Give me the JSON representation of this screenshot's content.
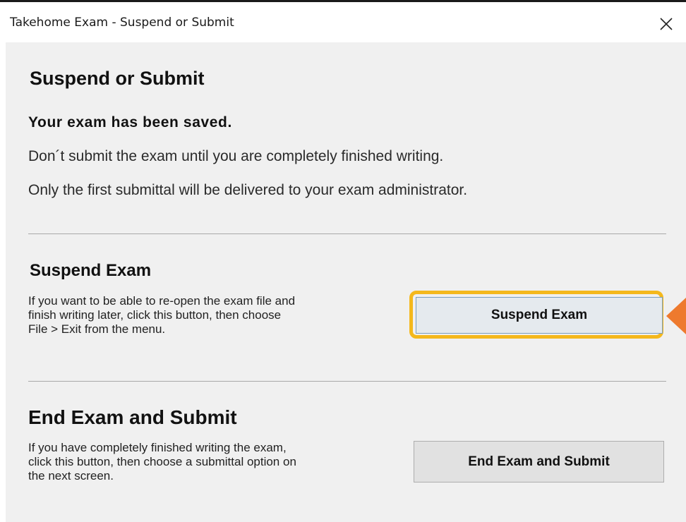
{
  "window": {
    "title": "Takehome Exam - Suspend or Submit",
    "close_glyph": "✕"
  },
  "intro": {
    "heading": "Suspend or Submit",
    "saved": "Your exam has been saved.",
    "line1": "Don´t submit the exam until you are completely finished writing.",
    "line2": "Only the first submittal will be delivered to your exam administrator."
  },
  "suspend": {
    "heading": "Suspend Exam",
    "description": "If you want to be able to re-open the exam file and\nfinish writing later, click this button, then choose\nFile > Exit from the menu.",
    "button_label": "Suspend Exam"
  },
  "end": {
    "heading": "End Exam and Submit",
    "description": "If you have completely finished writing the exam,\nclick this button, then choose a submittal option on\nthe next screen.",
    "button_label": "End Exam and Submit"
  },
  "colors": {
    "highlight": "#f4b81c",
    "callout_arrow": "#ee7a2e",
    "panel_bg": "#f0f0f0"
  },
  "icons": {
    "close": "close-icon",
    "callout": "callout-arrow-icon"
  }
}
